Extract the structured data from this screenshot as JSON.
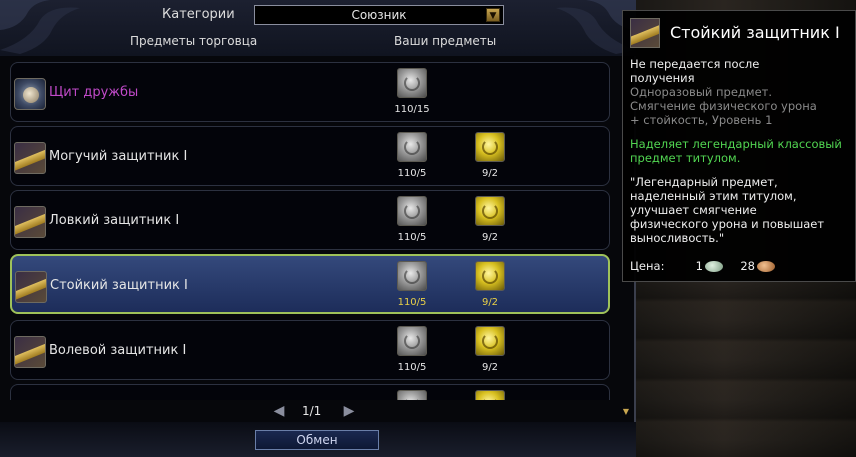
{
  "header": {
    "categories_label": "Категории",
    "category_selected": "Союзник",
    "col_merchant": "Предметы торговца",
    "col_yours": "Ваши предметы"
  },
  "rows": [
    {
      "name": "Щит дружбы",
      "silver": "110/15"
    },
    {
      "name": "Могучий защитник I",
      "silver": "110/5",
      "gold": "9/2"
    },
    {
      "name": "Ловкий защитник I",
      "silver": "110/5",
      "gold": "9/2"
    },
    {
      "name": "Стойкий защитник I",
      "silver": "110/5",
      "gold": "9/2",
      "selected": true
    },
    {
      "name": "Волевой защитник I",
      "silver": "110/5",
      "gold": "9/2"
    }
  ],
  "pager": {
    "page": "1/1"
  },
  "exchange_button": "Обмен",
  "tooltip": {
    "title": "Стойкий защитник I",
    "bind_line1": "Не передается после",
    "bind_line2": "получения",
    "desc_line1": "Одноразовый предмет.",
    "desc_line2": "Смягчение физического урона",
    "desc_line3": "+ стойкость, Уровень 1",
    "green_line1": "Наделяет легендарный классовый",
    "green_line2": "предмет титулом.",
    "quote_line1": "\"Легендарный предмет,",
    "quote_line2": "наделенный этим титулом,",
    "quote_line3": "улучшает смягчение",
    "quote_line4": "физического урона и повышает",
    "quote_line5": "выносливость.\"",
    "price_label": "Цена:",
    "price1": "1",
    "price2": "28"
  },
  "colors": {
    "accent_purple": "#c14ac9",
    "tooltip_green": "#52d652",
    "selected_border": "#9fc25a",
    "selected_count": "#e8d048"
  }
}
